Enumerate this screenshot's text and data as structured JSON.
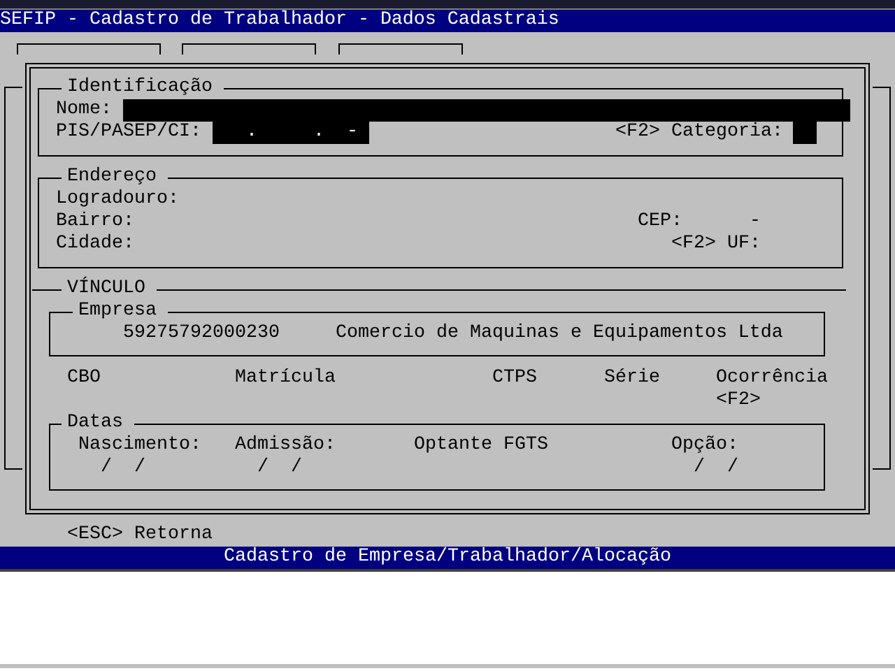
{
  "title_bar": {
    "title": "SEFIP - Cadastro de Trabalhador - Dados Cadastrais"
  },
  "identificacao": {
    "title": "Identificação",
    "nome_label": "Nome:",
    "pis_label": "PIS/PASEP/CI:",
    "pis_mask": "   .     .  -",
    "categoria_label": "<F2> Categoria:"
  },
  "endereco": {
    "title": "Endereço",
    "logradouro_label": "Logradouro:",
    "bairro_label": "Bairro:",
    "cep_label": "CEP:",
    "cep_mask": "-",
    "cidade_label": "Cidade:",
    "uf_label": "<F2> UF:"
  },
  "vinculo": {
    "title": "VÍNCULO",
    "empresa": {
      "title": "Empresa",
      "cnpj": "59275792000230",
      "razao_social": "Comercio de Maquinas e Equipamentos Ltda"
    },
    "columns": [
      "CBO",
      "Matrícula",
      "CTPS",
      "Série",
      "Ocorrência"
    ],
    "ocorrencia_hint": "<F2>",
    "datas": {
      "title": "Datas",
      "labels": [
        "Nascimento:",
        "Admissão:",
        "Optante FGTS",
        "Opção:"
      ],
      "date_masks": [
        "/  /",
        "/  /",
        "/  /"
      ]
    }
  },
  "footer": {
    "hint": "<ESC> Retorna"
  },
  "status_bar": {
    "text": "Cadastro de Empresa/Trabalhador/Alocação"
  }
}
